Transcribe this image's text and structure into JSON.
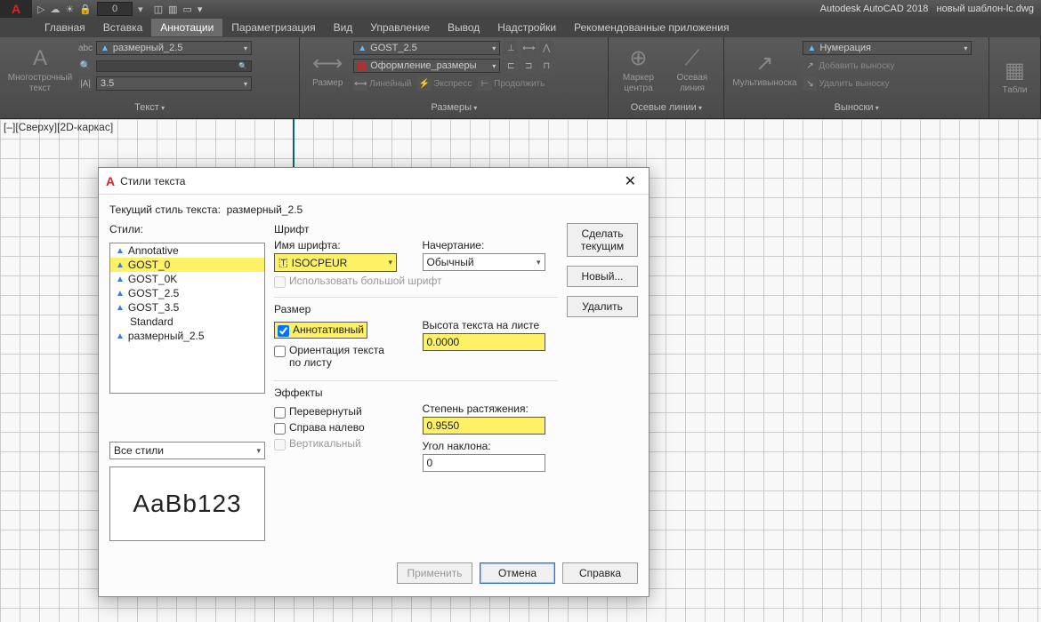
{
  "qat": {
    "num": "0",
    "app_title": "Autodesk AutoCAD 2018",
    "doc": "новый шаблон-lc.dwg"
  },
  "tabs": [
    "Главная",
    "Вставка",
    "Аннотации",
    "Параметризация",
    "Вид",
    "Управление",
    "Вывод",
    "Надстройки",
    "Рекомендованные приложения"
  ],
  "active_tab_index": 2,
  "ribbon": {
    "text": {
      "btn": "Многострочный\nтекст",
      "style_dd": "размерный_2.5",
      "height_dd": "3.5",
      "title": "Текст"
    },
    "dims": {
      "btn": "Размер",
      "style_dd": "GOST_2.5",
      "layer_dd": "Оформление_размеры",
      "sub": [
        "Линейный",
        "Экспресс",
        "Продолжить"
      ],
      "title": "Размеры"
    },
    "center": {
      "btn1": "Маркер\nцентра",
      "btn2": "Осевая линия",
      "title": "Осевые линии"
    },
    "leaders": {
      "btn": "Мультивыноска",
      "style_dd": "Нумерация",
      "link1": "Добавить выноску",
      "link2": "Удалить выноску",
      "title": "Выноски"
    },
    "table": {
      "btn": "Табли"
    }
  },
  "view_label": "[–][Сверху][2D-каркас]",
  "dialog": {
    "title": "Стили текста",
    "current_label": "Текущий стиль текста:",
    "current_value": "размерный_2.5",
    "styles_label": "Стили:",
    "styles": [
      "Annotative",
      "GOST_0",
      "GOST_0K",
      "GOST_2.5",
      "GOST_3.5",
      "Standard",
      "размерный_2.5"
    ],
    "selected_style_index": 1,
    "filter": "Все стили",
    "preview": "AaBb123",
    "font_group": "Шрифт",
    "font_name_label": "Имя шрифта:",
    "font_name": "ISOCPEUR",
    "font_style_label": "Начертание:",
    "font_style": "Обычный",
    "bigfont": "Использовать большой шрифт",
    "size_group": "Размер",
    "annotative": "Аннотативный",
    "orient": "Ориентация текста по листу",
    "paper_height_label": "Высота текста на листе",
    "paper_height": "0.0000",
    "effects_group": "Эффекты",
    "upside": "Перевернутый",
    "backwards": "Справа налево",
    "vertical": "Вертикальный",
    "widthfactor_label": "Степень растяжения:",
    "widthfactor": "0.9550",
    "oblique_label": "Угол наклона:",
    "oblique": "0",
    "btn_setcurrent": "Сделать текущим",
    "btn_new": "Новый...",
    "btn_delete": "Удалить",
    "btn_apply": "Применить",
    "btn_cancel": "Отмена",
    "btn_help": "Справка"
  }
}
